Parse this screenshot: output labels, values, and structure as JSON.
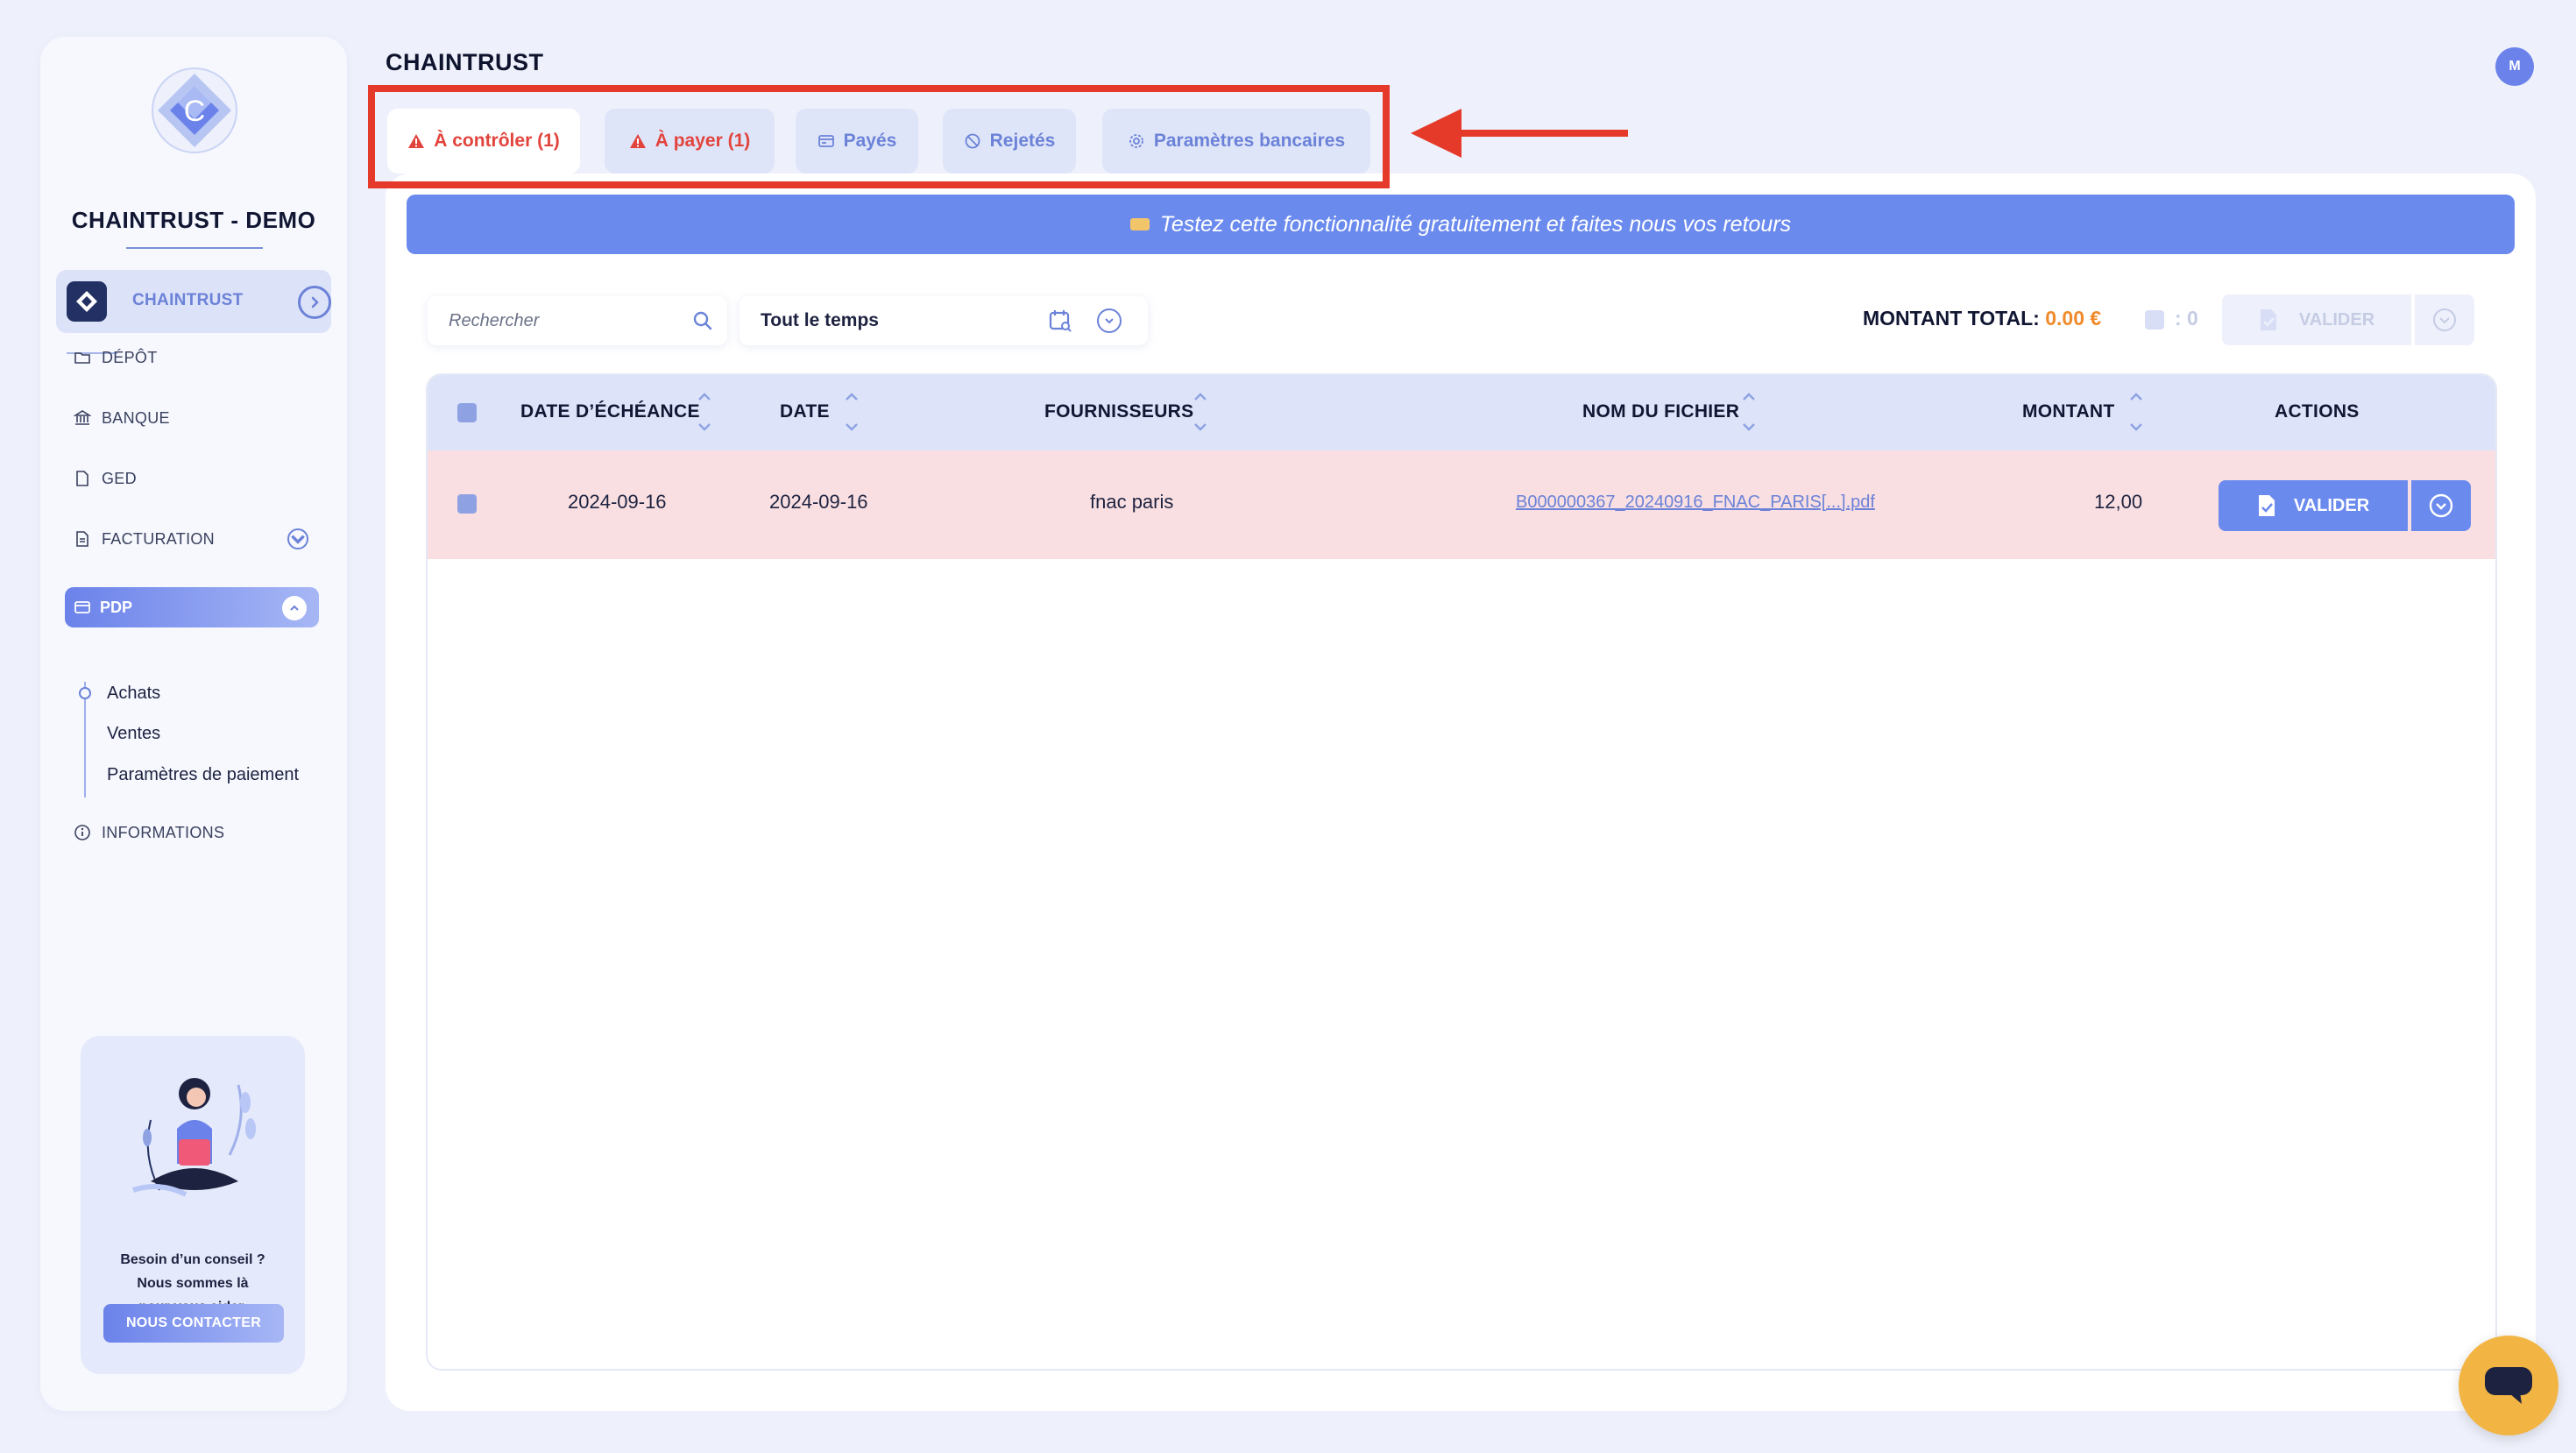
{
  "app": {
    "page_title": "CHAINTRUST",
    "user_initial": "M"
  },
  "sidebar": {
    "company_name": "CHAINTRUST - DEMO",
    "org_name": "CHAINTRUST",
    "nav": [
      {
        "label": "DÉPÔT",
        "icon": "folder-icon"
      },
      {
        "label": "BANQUE",
        "icon": "bank-icon"
      },
      {
        "label": "GED",
        "icon": "document-icon"
      },
      {
        "label": "FACTURATION",
        "icon": "invoice-icon"
      }
    ],
    "pdp": {
      "label": "PDP",
      "icon": "card-icon",
      "children": [
        "Achats",
        "Ventes",
        "Paramètres de paiement"
      ]
    },
    "informations": {
      "label": "INFORMATIONS",
      "icon": "info-icon"
    },
    "help": {
      "line1": "Besoin d’un conseil ?",
      "line2": "Nous sommes là",
      "line3": "pour vous aider.",
      "button": "NOUS CONTACTER"
    }
  },
  "tabs": [
    {
      "label": "À contrôler (1)",
      "icon": "warning-icon",
      "active": true
    },
    {
      "label": "À payer (1)",
      "icon": "warning-icon",
      "active": false
    },
    {
      "label": "Payés",
      "icon": "card-icon",
      "active": false
    },
    {
      "label": "Rejetés",
      "icon": "ban-icon",
      "active": false
    },
    {
      "label": "Paramètres bancaires",
      "icon": "gear-icon",
      "active": false
    }
  ],
  "banner": {
    "text": "Testez cette fonctionnalité gratuitement et faites nous vos retours"
  },
  "toolbar": {
    "search_placeholder": "Rechercher",
    "period": "Tout le temps",
    "total_label": "MONTANT TOTAL:",
    "total_value": "0.00 €",
    "selected_count": ": 0",
    "valider_label": "VALIDER"
  },
  "table": {
    "headers": [
      "DATE D’ÉCHÉANCE",
      "DATE",
      "FOURNISSEURS",
      "NOM DU FICHIER",
      "MONTANT",
      "ACTIONS"
    ],
    "rows": [
      {
        "due_date": "2024-09-16",
        "date": "2024-09-16",
        "supplier": "fnac paris",
        "filename": "B000000367_20240916_FNAC_PARIS[...].pdf",
        "amount": "12,00",
        "action": "VALIDER"
      }
    ]
  },
  "colors": {
    "accent": "#6b8aee",
    "highlight_box": "#e53a2a",
    "row_alert": "#f9dfe1",
    "total_value": "#f08a2a",
    "chat": "#f2b544"
  }
}
